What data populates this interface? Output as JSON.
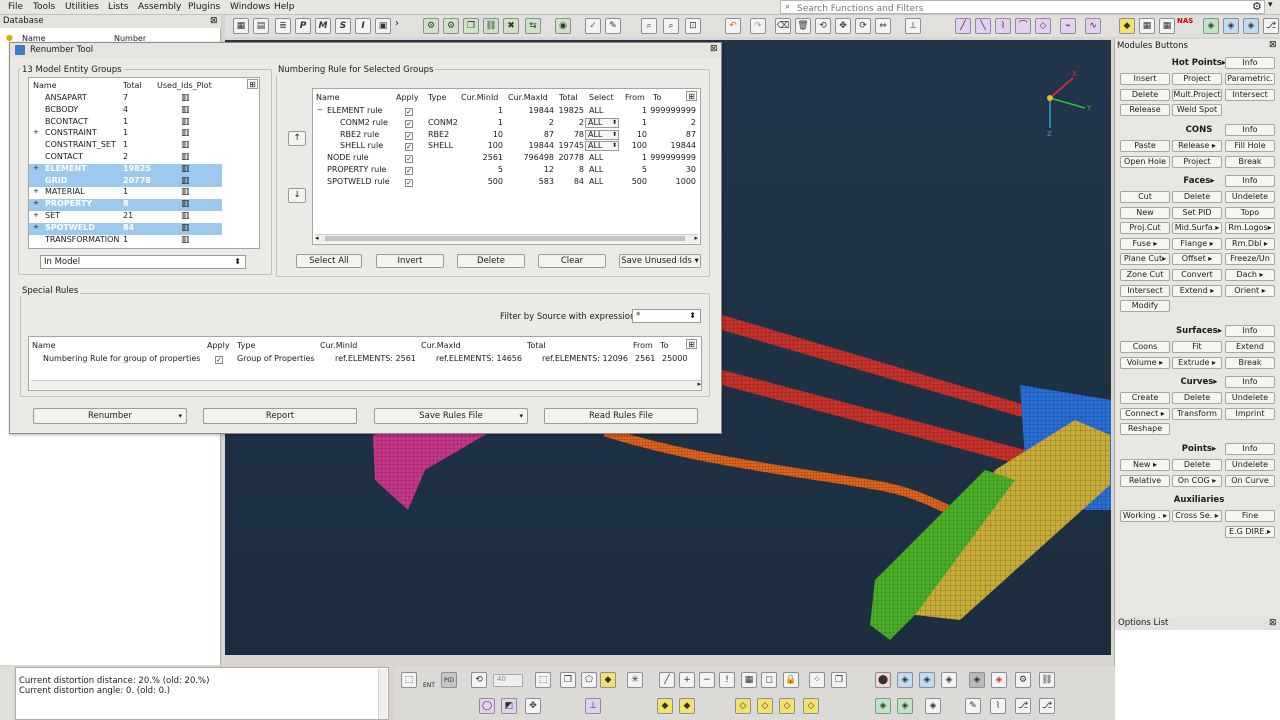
{
  "menubar": [
    "File",
    "Tools",
    "Utilities",
    "Lists",
    "Assembly",
    "Plugins",
    "Windows",
    "Help"
  ],
  "search": {
    "placeholder": "Search Functions and Filters"
  },
  "toolbar": {
    "p_icon": "P",
    "m_icon": "M",
    "s_icon": "S",
    "i_icon": "I",
    "nas_label": "NAS"
  },
  "database": {
    "title": "Database",
    "col_name": "Name",
    "col_number": "Number"
  },
  "dialog": {
    "title": "Renumber Tool",
    "left_group": "13 Model Entity Groups",
    "left_headers": {
      "name": "Name",
      "total": "Total",
      "used": "Used_Ids_Plot"
    },
    "entity_groups": [
      {
        "name": "ANSAPART",
        "total": "7",
        "selected": false,
        "expand": ""
      },
      {
        "name": "BCBODY",
        "total": "4",
        "selected": false,
        "expand": ""
      },
      {
        "name": "BCONTACT",
        "total": "1",
        "selected": false,
        "expand": ""
      },
      {
        "name": "CONSTRAINT",
        "total": "1",
        "selected": false,
        "expand": "+"
      },
      {
        "name": "CONSTRAINT_SET",
        "total": "1",
        "selected": false,
        "expand": ""
      },
      {
        "name": "CONTACT",
        "total": "2",
        "selected": false,
        "expand": ""
      },
      {
        "name": "ELEMENT",
        "total": "19825",
        "selected": true,
        "expand": "+"
      },
      {
        "name": "GRID",
        "total": "20778",
        "selected": true,
        "expand": ""
      },
      {
        "name": "MATERIAL",
        "total": "1",
        "selected": false,
        "expand": "+"
      },
      {
        "name": "PROPERTY",
        "total": "8",
        "selected": true,
        "expand": "+"
      },
      {
        "name": "SET",
        "total": "21",
        "selected": false,
        "expand": "+"
      },
      {
        "name": "SPOTWELD",
        "total": "84",
        "selected": true,
        "expand": "+"
      },
      {
        "name": "TRANSFORMATION",
        "total": "1",
        "selected": false,
        "expand": ""
      }
    ],
    "scope_combo": "In Model",
    "right_group": "Numbering Rule for Selected Groups",
    "rule_headers": {
      "name": "Name",
      "apply": "Apply",
      "type": "Type",
      "curmin": "Cur.MinId",
      "curmax": "Cur.MaxId",
      "total": "Total",
      "select": "Select",
      "from": "From",
      "to": "To"
    },
    "rules": [
      {
        "name": "ELEMENT rule",
        "indent": 0,
        "expand": "−",
        "type": "",
        "curmin": "1",
        "curmax": "19844",
        "total": "19825",
        "select": "ALL",
        "combo": false,
        "from": "1",
        "to": "999999999"
      },
      {
        "name": "CONM2 rule",
        "indent": 1,
        "expand": "",
        "type": "CONM2",
        "curmin": "1",
        "curmax": "2",
        "total": "2",
        "select": "ALL",
        "combo": true,
        "from": "1",
        "to": "2"
      },
      {
        "name": "RBE2 rule",
        "indent": 1,
        "expand": "",
        "type": "RBE2",
        "curmin": "10",
        "curmax": "87",
        "total": "78",
        "select": "ALL",
        "combo": true,
        "from": "10",
        "to": "87"
      },
      {
        "name": "SHELL rule",
        "indent": 1,
        "expand": "",
        "type": "SHELL",
        "curmin": "100",
        "curmax": "19844",
        "total": "19745",
        "select": "ALL",
        "combo": true,
        "from": "100",
        "to": "19844"
      },
      {
        "name": "NODE rule",
        "indent": 0,
        "expand": "",
        "type": "",
        "curmin": "2561",
        "curmax": "796498",
        "total": "20778",
        "select": "ALL",
        "combo": false,
        "from": "1",
        "to": "999999999"
      },
      {
        "name": "PROPERTY rule",
        "indent": 0,
        "expand": "",
        "type": "",
        "curmin": "5",
        "curmax": "12",
        "total": "8",
        "select": "ALL",
        "combo": false,
        "from": "5",
        "to": "30"
      },
      {
        "name": "SPOTWELD rule",
        "indent": 0,
        "expand": "",
        "type": "",
        "curmin": "500",
        "curmax": "583",
        "total": "84",
        "select": "ALL",
        "combo": false,
        "from": "500",
        "to": "1000"
      }
    ],
    "rule_buttons": {
      "select_all": "Select All",
      "invert": "Invert",
      "delete": "Delete",
      "clear": "Clear",
      "save_unused": "Save Unused Ids"
    },
    "special": {
      "title": "Special Rules",
      "filter_label": "Filter by Source with expression",
      "filter_value": "*",
      "headers": {
        "name": "Name",
        "apply": "Apply",
        "type": "Type",
        "curmin": "Cur.MinId",
        "curmax": "Cur.MaxId",
        "total": "Total",
        "from": "From",
        "to": "To"
      },
      "row": {
        "name": "Numbering Rule for group of properties",
        "type": "Group of Properties",
        "curmin": "ref.ELEMENTS: 2561",
        "curmax": "ref.ELEMENTS: 14656",
        "total": "ref.ELEMENTS: 12096",
        "from": "2561",
        "to": "25000"
      }
    },
    "footer": {
      "renumber": "Renumber",
      "report": "Report",
      "save_rules": "Save Rules File",
      "read_rules": "Read Rules File"
    }
  },
  "modules": {
    "title": "Modules Buttons",
    "sections": [
      {
        "head": "Hot Points▸",
        "info": "Info",
        "rows": [
          [
            "Insert",
            "Project",
            "Parametric."
          ],
          [
            "Delete",
            "Mult.Project",
            "Intersect"
          ],
          [
            "Release",
            "Weld Spot"
          ]
        ]
      },
      {
        "head": "CONS",
        "info": "Info",
        "rows": [
          [
            "Paste",
            "Release ▸",
            "Fill Hole"
          ],
          [
            "Open Hole",
            "Project",
            "Break"
          ]
        ]
      },
      {
        "head": "Faces▸",
        "info": "Info",
        "rows": [
          [
            "Cut",
            "Delete",
            "Undelete"
          ],
          [
            "New",
            "Set PID",
            "Topo"
          ],
          [
            "Proj.Cut",
            "Mid.Surfa.▸",
            "Rm.Logos▸"
          ],
          [
            "Fuse ▸",
            "Flange ▸",
            "Rm.Dbl ▸"
          ],
          [
            "Plane Cut▸",
            "Offset ▸",
            "Freeze/Un"
          ],
          [
            "Zone Cut",
            "Convert",
            "Dach ▸"
          ],
          [
            "Intersect",
            "Extend ▸",
            "Orient ▸"
          ],
          [
            "Modify"
          ]
        ]
      },
      {
        "head": "Surfaces▸",
        "info": "Info",
        "rows": [
          [
            "Coons",
            "Fit",
            "Extend"
          ],
          [
            "Volume ▸",
            "Extrude ▸",
            "Break"
          ]
        ]
      },
      {
        "head": "Curves▸",
        "info": "Info",
        "rows": [
          [
            "Create",
            "Delete",
            "Undelete"
          ],
          [
            "Connect ▸",
            "Transform",
            "Imprint"
          ],
          [
            "Reshape"
          ]
        ]
      },
      {
        "head": "Points▸",
        "info": "Info",
        "rows": [
          [
            "New ▸",
            "Delete",
            "Undelete"
          ],
          [
            "Relative",
            "On COG ▸",
            "On Curve"
          ]
        ]
      },
      {
        "head": "Auxiliaries",
        "info": "",
        "rows": [
          [
            "Working . ▸",
            "Cross Se. ▸",
            "Fine"
          ],
          [
            "",
            "",
            "E.G DIRE.▸"
          ]
        ]
      }
    ]
  },
  "options": {
    "title": "Options List"
  },
  "log": [
    "Current distortion distance: 20.% (old: 20.%)",
    "Current distortion angle: 0. (old: 0.)"
  ],
  "bottom": {
    "ent": "ENT",
    "pid": "PID",
    "zoom": "40"
  },
  "axis": {
    "x": "X",
    "y": "Y",
    "z": "Z"
  },
  "colors": {
    "selection": "#9ec9ef",
    "viewport": "#1f3346",
    "red_mesh": "#c8322c",
    "orange_mesh": "#e0641e",
    "yellow_mesh": "#c8ac3a",
    "green_mesh": "#4caf2a",
    "blue_mesh": "#2a6fd6",
    "pink_mesh": "#c8388a"
  }
}
